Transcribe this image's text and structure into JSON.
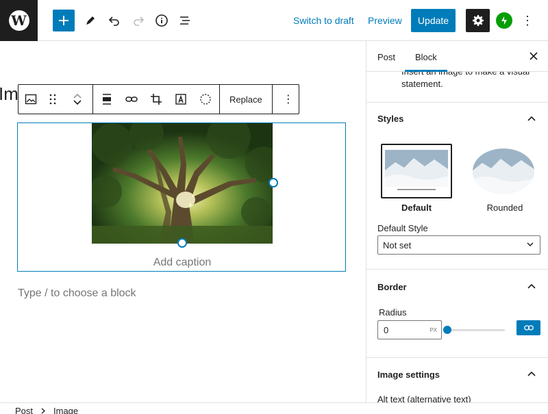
{
  "topbar": {
    "logo_glyph": "W",
    "add_icon": "plus-icon",
    "switch_to_draft": "Switch to draft",
    "preview": "Preview",
    "update": "Update",
    "more_glyph": "⋮"
  },
  "editor": {
    "title_fragment": "Im",
    "toolbar": {
      "replace_label": "Replace",
      "more_glyph": "⋮"
    },
    "caption_placeholder": "Add caption",
    "appender_placeholder": "Type / to choose a block"
  },
  "sidebar": {
    "tabs": [
      {
        "label": "Post"
      },
      {
        "label": "Block"
      }
    ],
    "active_tab": "Block",
    "description": "Insert an image to make a visual statement.",
    "styles": {
      "title": "Styles",
      "options": [
        {
          "label": "Default",
          "selected": true
        },
        {
          "label": "Rounded",
          "selected": false
        }
      ],
      "default_style_label": "Default Style",
      "default_style_value": "Not set"
    },
    "border": {
      "title": "Border",
      "radius_label": "Radius",
      "radius_value": "0",
      "radius_unit": "PX",
      "radius_slider_fraction": 0
    },
    "image_settings": {
      "title": "Image settings",
      "alt_text_label": "Alt text (alternative text)"
    }
  },
  "footer": {
    "breadcrumb": [
      "Post",
      "Image"
    ]
  },
  "colors": {
    "accent": "#007cba",
    "dark": "#1e1e1e",
    "jetpack": "#069e08",
    "muted": "#757575"
  }
}
